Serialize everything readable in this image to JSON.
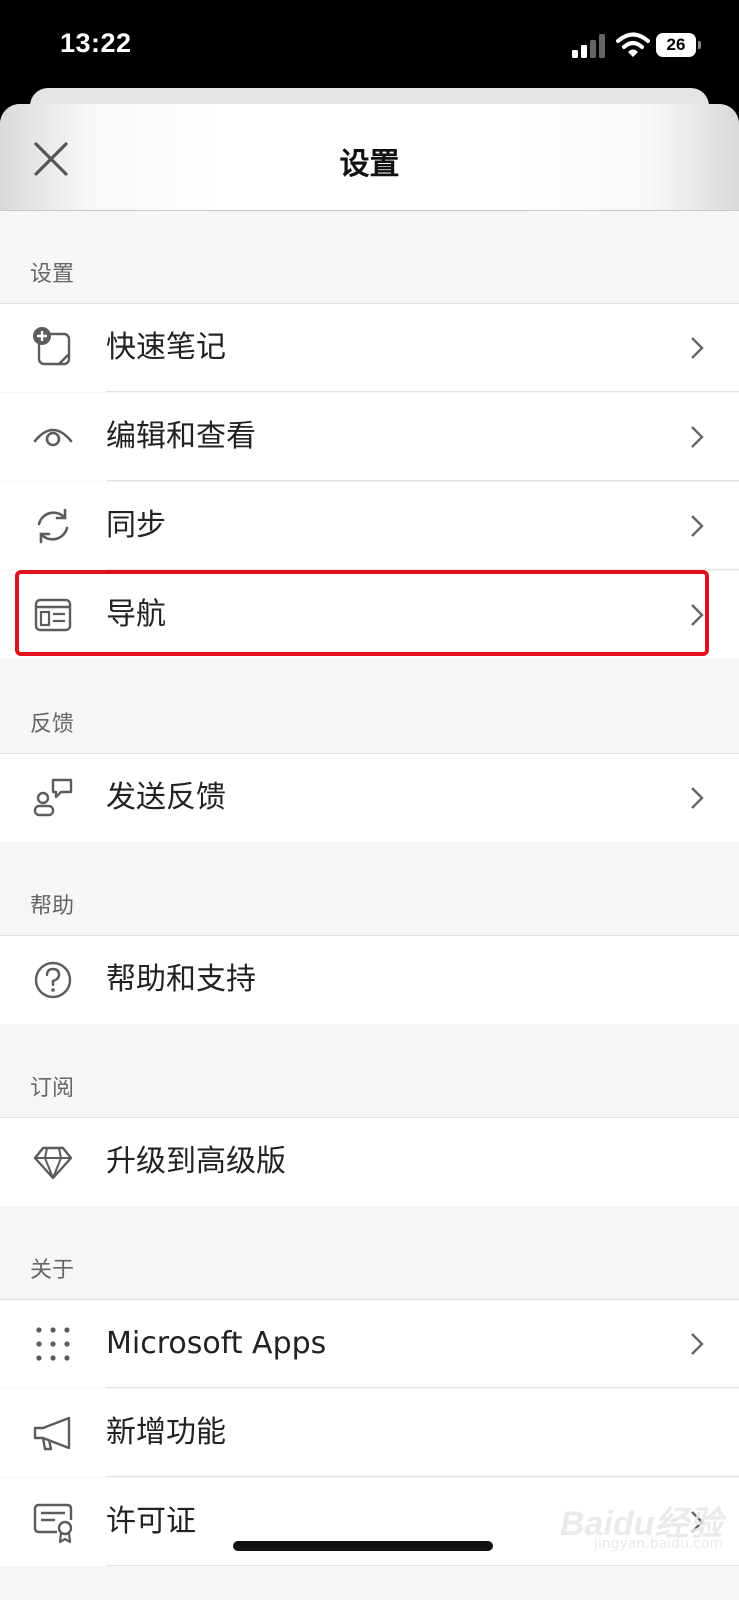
{
  "status_bar": {
    "time": "13:22",
    "battery": "26"
  },
  "header": {
    "title": "设置"
  },
  "sections": [
    {
      "title": "设置",
      "items": [
        {
          "label": "快速笔记",
          "icon": "quick-note-icon",
          "chevron": true
        },
        {
          "label": "编辑和查看",
          "icon": "eye-icon",
          "chevron": true
        },
        {
          "label": "同步",
          "icon": "sync-icon",
          "chevron": true
        },
        {
          "label": "导航",
          "icon": "navigation-icon",
          "chevron": true,
          "highlighted": true
        }
      ]
    },
    {
      "title": "反馈",
      "items": [
        {
          "label": "发送反馈",
          "icon": "feedback-icon",
          "chevron": true
        }
      ]
    },
    {
      "title": "帮助",
      "items": [
        {
          "label": "帮助和支持",
          "icon": "help-icon",
          "chevron": false
        }
      ]
    },
    {
      "title": "订阅",
      "items": [
        {
          "label": "升级到高级版",
          "icon": "diamond-icon",
          "chevron": false
        }
      ]
    },
    {
      "title": "关于",
      "items": [
        {
          "label": "Microsoft Apps",
          "icon": "apps-grid-icon",
          "chevron": true
        },
        {
          "label": "新增功能",
          "icon": "megaphone-icon",
          "chevron": false
        },
        {
          "label": "许可证",
          "icon": "license-icon",
          "chevron": true
        }
      ]
    }
  ],
  "watermark": {
    "text": "Baidu经验",
    "sub": "jingyan.baidu.com"
  },
  "colors": {
    "highlight": "#e0101e",
    "background": "#f6f6f6"
  }
}
